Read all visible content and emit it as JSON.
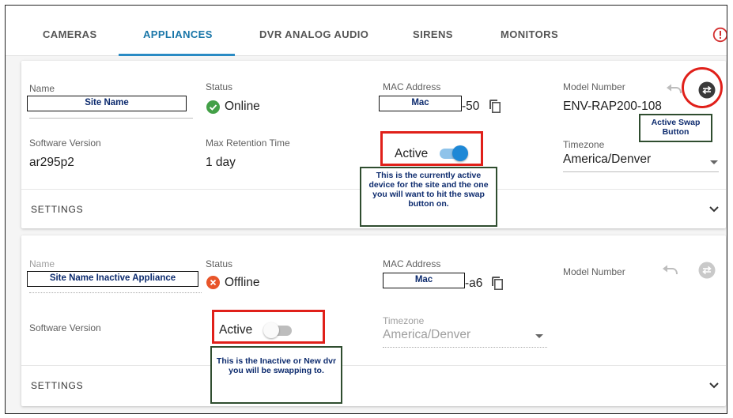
{
  "tabs": [
    {
      "label": "CAMERAS"
    },
    {
      "label": "APPLIANCES"
    },
    {
      "label": "DVR ANALOG AUDIO"
    },
    {
      "label": "SIRENS"
    },
    {
      "label": "MONITORS"
    }
  ],
  "active_tab": "APPLIANCES",
  "colors": {
    "accent": "#1976a8",
    "online": "#43a047",
    "offline": "#e8552a",
    "annotation_red": "#e0201a"
  },
  "appliance_active": {
    "name_label": "Name",
    "name_value": "Site Name",
    "status_label": "Status",
    "status_value": "Online",
    "status_icon": "check-circle-icon",
    "mac_label": "MAC Address",
    "mac_redacted": "Mac",
    "mac_suffix": "-50",
    "model_label": "Model Number",
    "model_value": "ENV-RAP200-108",
    "software_label": "Software Version",
    "software_value": "ar295p2",
    "retention_label": "Max Retention Time",
    "retention_value": "1 day",
    "active_label": "Active",
    "active_on": true,
    "timezone_label": "Timezone",
    "timezone_value": "America/Denver",
    "settings_label": "SETTINGS"
  },
  "appliance_inactive": {
    "name_label": "Name",
    "name_value": "Site Name Inactive Appliance",
    "status_label": "Status",
    "status_value": "Offline",
    "status_icon": "error-circle-icon",
    "mac_label": "MAC Address",
    "mac_redacted": "Mac",
    "mac_suffix": "-a6",
    "model_label": "Model Number",
    "software_label": "Software Version",
    "active_label": "Active",
    "active_on": false,
    "timezone_label": "Timezone",
    "timezone_value": "America/Denver",
    "settings_label": "SETTINGS"
  },
  "annotations": {
    "swap_button_note": "Active Swap Button",
    "active_note": "This is the currently active device for the site and the one you will want to hit the swap button on.",
    "inactive_note": "This is the Inactive or New dvr you will be swapping to."
  }
}
